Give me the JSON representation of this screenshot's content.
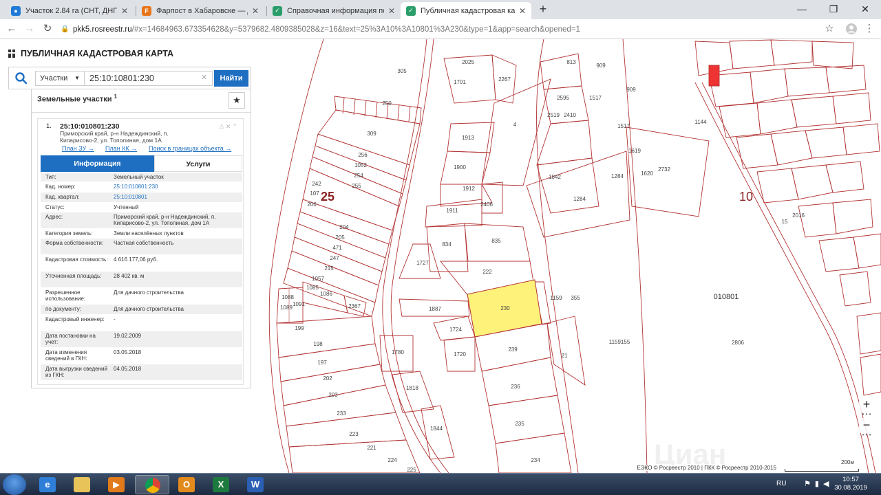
{
  "browser": {
    "tabs": [
      {
        "label": "Участок 2.84 га (СНТ, ДНП) - ку",
        "icon": "cian-icon",
        "color": "#1e7ad6"
      },
      {
        "label": "Фарпост в Хабаровске — Доск",
        "icon": "farpost-icon",
        "color": "#e8751a"
      },
      {
        "label": "Справочная информация по об",
        "icon": "rosreestr-icon",
        "color": "#2a9d6a"
      },
      {
        "label": "Публичная кадастровая карта",
        "icon": "pkk-icon",
        "color": "#2a9d6a",
        "active": true
      }
    ],
    "new_tab": "+",
    "url_host": "pkk5.rosreestr.ru",
    "url_rest": "/#x=14684963.673354628&y=5379682.4809385028&z=16&text=25%3A10%3A10801%3A230&type=1&app=search&opened=1"
  },
  "app": {
    "title": "ПУБЛИЧНАЯ КАДАСТРОВАЯ КАРТА"
  },
  "search": {
    "type": "Участки",
    "value": "25:10:10801:230",
    "button": "Найти"
  },
  "panel": {
    "header": "Земельные участки",
    "header_count": "1",
    "result": {
      "num": "1.",
      "cad_number": "25:10:010801:230",
      "address": "Приморский край, р-н Надеждинский, п. Кипарисово-2, ул. Тополиная, дом 1А",
      "links": [
        "План ЗУ →",
        "План КК →",
        "Поиск в границах объекта →"
      ]
    },
    "tabs": {
      "info": "Информация",
      "services": "Услуги"
    },
    "info_rows": [
      {
        "k": "Тип:",
        "v": "Земельный участок"
      },
      {
        "k": "Кад. номер:",
        "v": "25:10:010801:230",
        "link": true
      },
      {
        "k": "Кад. квартал:",
        "v": "25:10:010801",
        "link": true
      },
      {
        "k": "Статус:",
        "v": "Учтенный"
      },
      {
        "k": "Адрес:",
        "v": "Приморский край, р-н Надеждинский, п. Кипарисово-2, ул. Тополиная, дом 1А"
      },
      {
        "k": "Категория земель:",
        "v": "Земли населённых пунктов"
      },
      {
        "k": "Форма собственности:",
        "v": "Частная собственность"
      },
      {
        "k": "Кадастровая стоимость:",
        "v": "4 616 177,06 руб."
      },
      {
        "k": "Уточненная площадь:",
        "v": "28 402 кв. м"
      },
      {
        "k": "Разрешенное использование:",
        "v": "Для дачного строительства"
      },
      {
        "k": "по документу:",
        "v": "Для дачного строительства"
      },
      {
        "k": "Кадастровый инженер:",
        "v": "-"
      },
      {
        "k": "Дата постановки на учет:",
        "v": "19.02.2009"
      },
      {
        "k": "Дата изменения сведений в ГКН:",
        "v": "03.05.2018"
      },
      {
        "k": "Дата выгрузки сведений из ГКН:",
        "v": "04.05.2018"
      }
    ]
  },
  "map": {
    "quarters": [
      "25",
      "10",
      "010801"
    ],
    "parcel_labels": {
      "p305": "305",
      "p250": "250",
      "p309": "309",
      "p256": "256",
      "p1052": "1052",
      "p254": "254",
      "p255": "255",
      "p242": "242",
      "p107": "107",
      "p206": "206",
      "p204": "204",
      "p205": "205",
      "p471": "471",
      "p247": "247",
      "p215": "215",
      "p1057": "1057",
      "p1085": "1085",
      "p1086": "1086",
      "p1088": "1088",
      "p1089": "1089",
      "p1091": "1091",
      "p2367": "2367",
      "p199": "199",
      "p198": "198",
      "p197": "197",
      "p202": "202",
      "p203": "203",
      "p233": "233",
      "p223": "223",
      "p221": "221",
      "p224": "224",
      "p225": "225",
      "p2025": "2025",
      "p1701": "1701",
      "p2267": "2267",
      "p813": "813",
      "p909a": "909",
      "p909b": "909",
      "p2595": "2595",
      "p2519": "2519",
      "p2410": "2410",
      "p1517a": "1517",
      "p1517b": "1517",
      "p4": "4",
      "p1913": "1913",
      "p1900": "1900",
      "p1912": "1912",
      "p1911": "1911",
      "p2406": "2406",
      "p1842": "1842",
      "p1284a": "1284",
      "p1284b": "1284",
      "p1619": "1619",
      "p1620": "1620",
      "p2732": "2732",
      "p834": "834",
      "p835": "835",
      "p1727": "1727",
      "p222": "222",
      "p230": "230",
      "p1159": "1159",
      "p355": "355",
      "p1887": "1887",
      "p1724": "1724",
      "p1720": "1720",
      "p1780": "1780",
      "p239": "239",
      "p21": "21",
      "p1159155": "1159155",
      "p2806": "2806",
      "p236": "236",
      "p1818": "1818",
      "p1844": "1844",
      "p235": "235",
      "p234": "234",
      "p1144": "1144",
      "p15": "15",
      "p2016": "2016"
    },
    "selected_color": "#fff27a",
    "copyright": "ЕЭКО © Росреестр 2010 | ПКК © Росреестр 2010-2015",
    "scale": "200м",
    "zoom_in": "+",
    "zoom_out": "−",
    "watermark": "Циан"
  },
  "taskbar": {
    "lang": "RU",
    "time": "10:57",
    "date": "30.08.2019",
    "apps": [
      {
        "icon": "ie-icon",
        "glyph": "e",
        "color": "#2f7fd8"
      },
      {
        "icon": "explorer-icon",
        "glyph": "",
        "color": "#e8c35a"
      },
      {
        "icon": "media-player-icon",
        "glyph": "▶",
        "color": "#e07a1a"
      },
      {
        "icon": "chrome-icon",
        "glyph": "",
        "color": "#3aa757"
      },
      {
        "icon": "outlook-icon",
        "glyph": "O",
        "color": "#e28a1c"
      },
      {
        "icon": "excel-icon",
        "glyph": "X",
        "color": "#1d7a3e"
      },
      {
        "icon": "word-icon",
        "glyph": "W",
        "color": "#2b5fb4"
      }
    ]
  }
}
